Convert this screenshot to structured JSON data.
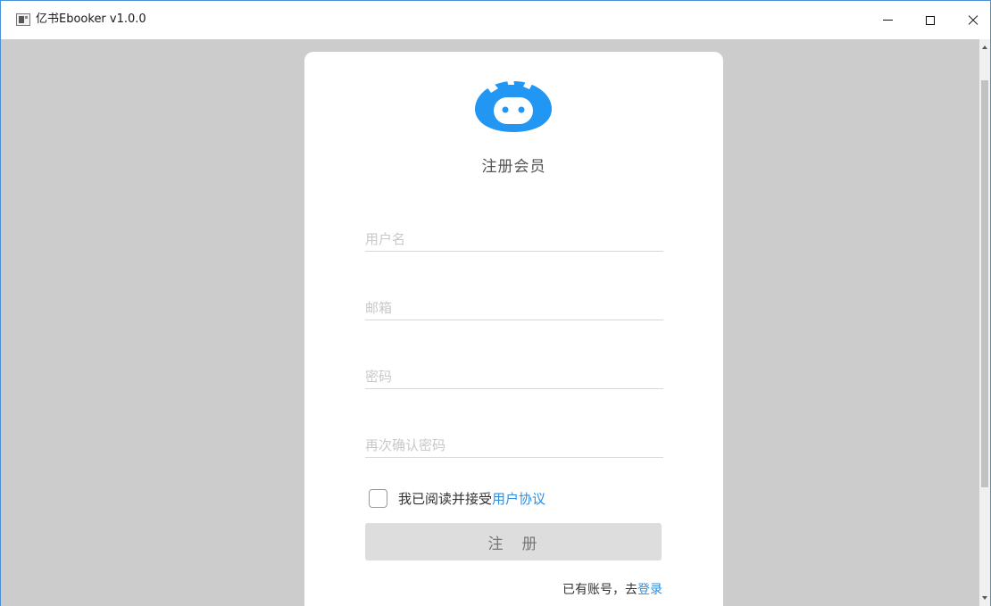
{
  "window": {
    "title": "亿书Ebooker v1.0.0"
  },
  "register": {
    "title": "注册会员",
    "username_placeholder": "用户名",
    "email_placeholder": "邮箱",
    "password_placeholder": "密码",
    "confirm_password_placeholder": "再次确认密码",
    "agree_text": "我已阅读并接受",
    "agree_link": "用户协议",
    "submit_label": "注　册",
    "has_account_text": "已有账号，去",
    "login_link": "登录"
  },
  "colors": {
    "accent": "#2196F3",
    "link": "#2e8fe0",
    "background": "#cccccc",
    "button_disabled": "#dddddd"
  },
  "icons": {
    "logo": "robot-face-logo-icon",
    "minimize": "minimize-icon",
    "maximize": "maximize-icon",
    "close": "close-icon"
  }
}
